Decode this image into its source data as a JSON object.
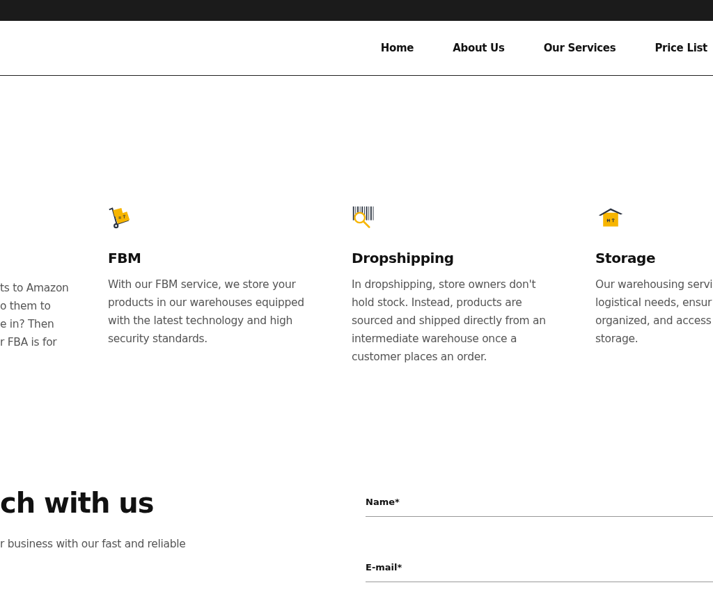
{
  "nav": {
    "items": [
      {
        "label": "Home"
      },
      {
        "label": "About Us"
      },
      {
        "label": "Our Services"
      },
      {
        "label": "Price List"
      }
    ]
  },
  "services": [
    {
      "lines": [
        "ts to Amazon",
        "o them to",
        "e in? Then",
        "r FBA is for"
      ]
    },
    {
      "title": "FBM",
      "text": "With our FBM service, we store your products in our warehouses equipped with the latest technology and high security standards."
    },
    {
      "title": "Dropshipping",
      "text": "In dropshipping, store owners don't hold stock. Instead, products are sourced and shipped directly from an intermediate warehouse once a customer places an order."
    },
    {
      "title": "Storage",
      "lines": [
        "Our warehousing servi",
        "logistical needs, ensur",
        "organized, and access",
        "storage."
      ]
    }
  ],
  "contact": {
    "title": "ch with us",
    "text": "r business with our fast and reliable",
    "fields": [
      {
        "label": "Name*"
      },
      {
        "label": "E-mail*"
      }
    ]
  }
}
